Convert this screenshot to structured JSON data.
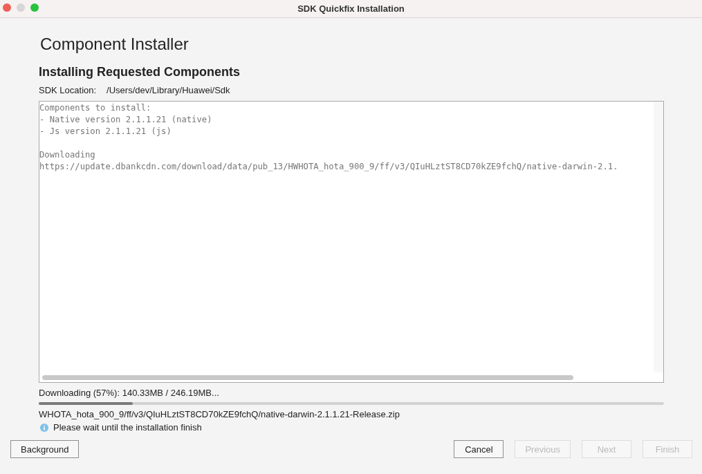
{
  "window": {
    "title": "SDK Quickfix Installation"
  },
  "heading": "Component Installer",
  "subheading": "Installing Requested Components",
  "sdk_location": {
    "label": "SDK Location:",
    "value": "/Users/dev/Library/Huawei/Sdk"
  },
  "log_blocks": [
    [
      "Components to install:",
      "- Native version 2.1.1.21 (native)",
      "- Js version 2.1.1.21 (js)"
    ],
    [
      "Downloading",
      "https://update.dbankcdn.com/download/data/pub_13/HWHOTA_hota_900_9/ff/v3/QIuHLztST8CD70kZE9fchQ/native-darwin-2.1."
    ]
  ],
  "progress": {
    "status": "Downloading (57%): 140.33MB / 246.19MB...",
    "level": 0.15,
    "file": "WHOTA_hota_900_9/ff/v3/QIuHLztST8CD70kZE9fchQ/native-darwin-2.1.1.21-Release.zip"
  },
  "info": "Please wait until the installation finish",
  "buttons": [
    {
      "label": "Background",
      "disabled": false,
      "kind": "left"
    },
    {
      "label": "Cancel",
      "disabled": false,
      "kind": "right"
    },
    {
      "label": "Previous",
      "disabled": true,
      "kind": "right"
    },
    {
      "label": "Next",
      "disabled": true,
      "kind": "right"
    },
    {
      "label": "Finish",
      "disabled": true,
      "kind": "right"
    }
  ]
}
